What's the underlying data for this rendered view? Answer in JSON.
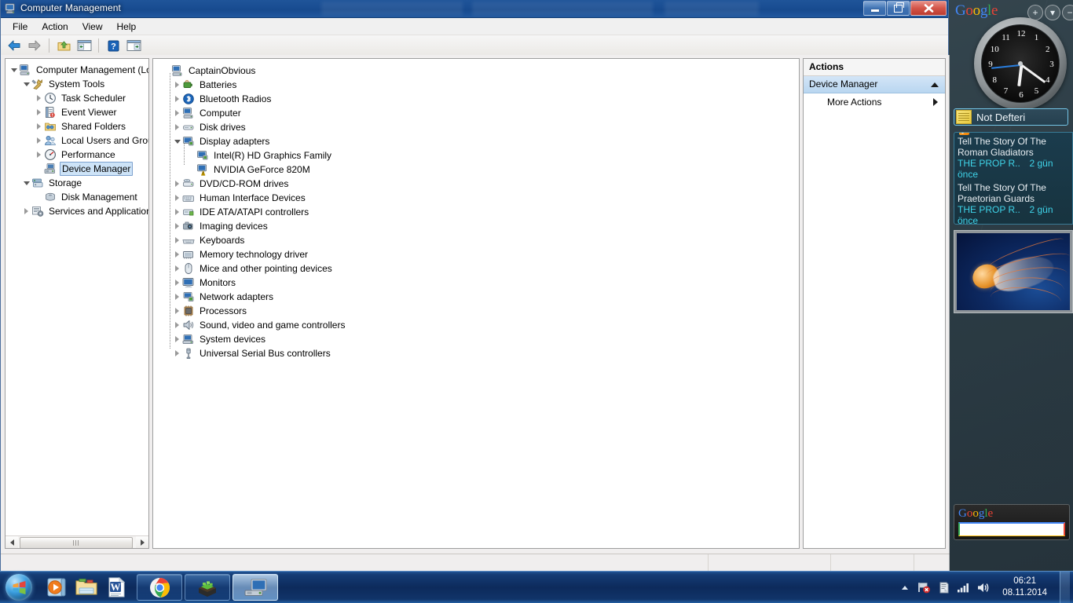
{
  "window": {
    "title": "Computer Management",
    "icon": "computer-management-icon",
    "buttons": {
      "minimize": "Minimize",
      "restore": "Restore",
      "close": "Close"
    }
  },
  "menubar": {
    "items": [
      "File",
      "Action",
      "View",
      "Help"
    ]
  },
  "toolbar": {
    "items": [
      {
        "name": "back-icon",
        "title": "Back"
      },
      {
        "name": "forward-icon",
        "title": "Forward"
      },
      {
        "name": "up-folder-icon",
        "title": "Up One Level"
      },
      {
        "name": "show-hide-tree-icon",
        "title": "Show/Hide Console Tree"
      },
      {
        "name": "help-icon",
        "title": "Help"
      },
      {
        "name": "properties-icon",
        "title": "Properties"
      }
    ]
  },
  "console_tree": {
    "items": [
      {
        "label": "Computer Management (Local",
        "level": 0,
        "state": "expanded",
        "icon": "computer-icon",
        "selected": false
      },
      {
        "label": "System Tools",
        "level": 1,
        "state": "expanded",
        "icon": "system-tools-icon",
        "selected": false
      },
      {
        "label": "Task Scheduler",
        "level": 2,
        "state": "collapsed",
        "icon": "clock-icon",
        "selected": false
      },
      {
        "label": "Event Viewer",
        "level": 2,
        "state": "collapsed",
        "icon": "event-viewer-icon",
        "selected": false
      },
      {
        "label": "Shared Folders",
        "level": 2,
        "state": "collapsed",
        "icon": "shared-folders-icon",
        "selected": false
      },
      {
        "label": "Local Users and Groups",
        "level": 2,
        "state": "collapsed",
        "icon": "users-icon",
        "selected": false
      },
      {
        "label": "Performance",
        "level": 2,
        "state": "collapsed",
        "icon": "performance-icon",
        "selected": false
      },
      {
        "label": "Device Manager",
        "level": 2,
        "state": "leaf",
        "icon": "device-manager-icon",
        "selected": true
      },
      {
        "label": "Storage",
        "level": 1,
        "state": "expanded",
        "icon": "storage-icon",
        "selected": false
      },
      {
        "label": "Disk Management",
        "level": 2,
        "state": "leaf",
        "icon": "disk-management-icon",
        "selected": false
      },
      {
        "label": "Services and Applications",
        "level": 1,
        "state": "collapsed",
        "icon": "services-icon",
        "selected": false
      }
    ],
    "scrollbar": {
      "left_arrow": "◀",
      "right_arrow": "▶"
    }
  },
  "device_tree": {
    "root": {
      "label": "CaptainObvious",
      "icon": "computer-node-icon"
    },
    "items": [
      {
        "label": "Batteries",
        "state": "collapsed",
        "icon": "battery-icon",
        "level": 1
      },
      {
        "label": "Bluetooth Radios",
        "state": "collapsed",
        "icon": "bluetooth-icon",
        "level": 1
      },
      {
        "label": "Computer",
        "state": "collapsed",
        "icon": "computer-icon",
        "level": 1
      },
      {
        "label": "Disk drives",
        "state": "collapsed",
        "icon": "disk-drive-icon",
        "level": 1
      },
      {
        "label": "Display adapters",
        "state": "expanded",
        "icon": "display-adapter-icon",
        "level": 1
      },
      {
        "label": "Intel(R) HD Graphics Family",
        "state": "leaf",
        "icon": "display-adapter-icon",
        "level": 2
      },
      {
        "label": "NVIDIA GeForce 820M",
        "state": "leaf",
        "icon": "display-adapter-warning-icon",
        "level": 2,
        "warning": true
      },
      {
        "label": "DVD/CD-ROM drives",
        "state": "collapsed",
        "icon": "dvd-drive-icon",
        "level": 1
      },
      {
        "label": "Human Interface Devices",
        "state": "collapsed",
        "icon": "hid-icon",
        "level": 1
      },
      {
        "label": "IDE ATA/ATAPI controllers",
        "state": "collapsed",
        "icon": "ide-controller-icon",
        "level": 1
      },
      {
        "label": "Imaging devices",
        "state": "collapsed",
        "icon": "camera-icon",
        "level": 1
      },
      {
        "label": "Keyboards",
        "state": "collapsed",
        "icon": "keyboard-icon",
        "level": 1
      },
      {
        "label": "Memory technology driver",
        "state": "collapsed",
        "icon": "memory-icon",
        "level": 1
      },
      {
        "label": "Mice and other pointing devices",
        "state": "collapsed",
        "icon": "mouse-icon",
        "level": 1
      },
      {
        "label": "Monitors",
        "state": "collapsed",
        "icon": "monitor-icon",
        "level": 1
      },
      {
        "label": "Network adapters",
        "state": "collapsed",
        "icon": "network-adapter-icon",
        "level": 1
      },
      {
        "label": "Processors",
        "state": "collapsed",
        "icon": "processor-icon",
        "level": 1
      },
      {
        "label": "Sound, video and game controllers",
        "state": "collapsed",
        "icon": "speaker-icon",
        "level": 1
      },
      {
        "label": "System devices",
        "state": "collapsed",
        "icon": "system-device-icon",
        "level": 1
      },
      {
        "label": "Universal Serial Bus controllers",
        "state": "collapsed",
        "icon": "usb-icon",
        "level": 1
      }
    ]
  },
  "actions": {
    "header": "Actions",
    "group": "Device Manager",
    "items": [
      {
        "label": "More Actions",
        "has_submenu": true
      }
    ]
  },
  "sidebar": {
    "brand": "Google",
    "controls": [
      "+",
      "▾",
      "−"
    ],
    "clock": {
      "time": "06:21",
      "numerals": [
        "12",
        "1",
        "2",
        "3",
        "4",
        "5",
        "6",
        "7",
        "8",
        "9",
        "10",
        "11"
      ]
    },
    "notes": {
      "label": "Not Defteri",
      "icon": "sticky-note-icon"
    },
    "rss": {
      "icon": "rss-icon",
      "feeds": [
        {
          "title": "Tell The Story Of The Roman Gladiators",
          "source": "THE PROP R..",
          "age": "2 gün önce"
        },
        {
          "title": "Tell The Story Of The Praetorian Guards",
          "source": "THE PROP R..",
          "age": "2 gün önce"
        }
      ]
    },
    "picture": {
      "alt": "jellyfish-photo"
    },
    "search": {
      "brand": "Google",
      "value": "",
      "placeholder": ""
    }
  },
  "taskbar": {
    "start": "start-orb",
    "quick_launch": [
      {
        "name": "windows-media-player-icon"
      },
      {
        "name": "windows-explorer-icon"
      },
      {
        "name": "microsoft-word-icon"
      }
    ],
    "tasks": [
      {
        "name": "google-chrome-task",
        "active": false
      },
      {
        "name": "minecraft-task",
        "active": false
      },
      {
        "name": "computer-management-task",
        "active": true
      }
    ],
    "tray": {
      "show_hidden": "▴",
      "icons": [
        "network-error-icon",
        "action-center-icon",
        "signal-icon",
        "volume-icon"
      ],
      "time": "06:21",
      "date": "08.11.2014"
    }
  },
  "colors": {
    "titlebar_blue": "#1a4e93",
    "selection_blue": "#cde3f7",
    "actions_group_blue": "#b9d6f0",
    "desktop": "#2f4049",
    "rss_accent": "#3fd3e8",
    "warning_yellow": "#ffcc00"
  }
}
